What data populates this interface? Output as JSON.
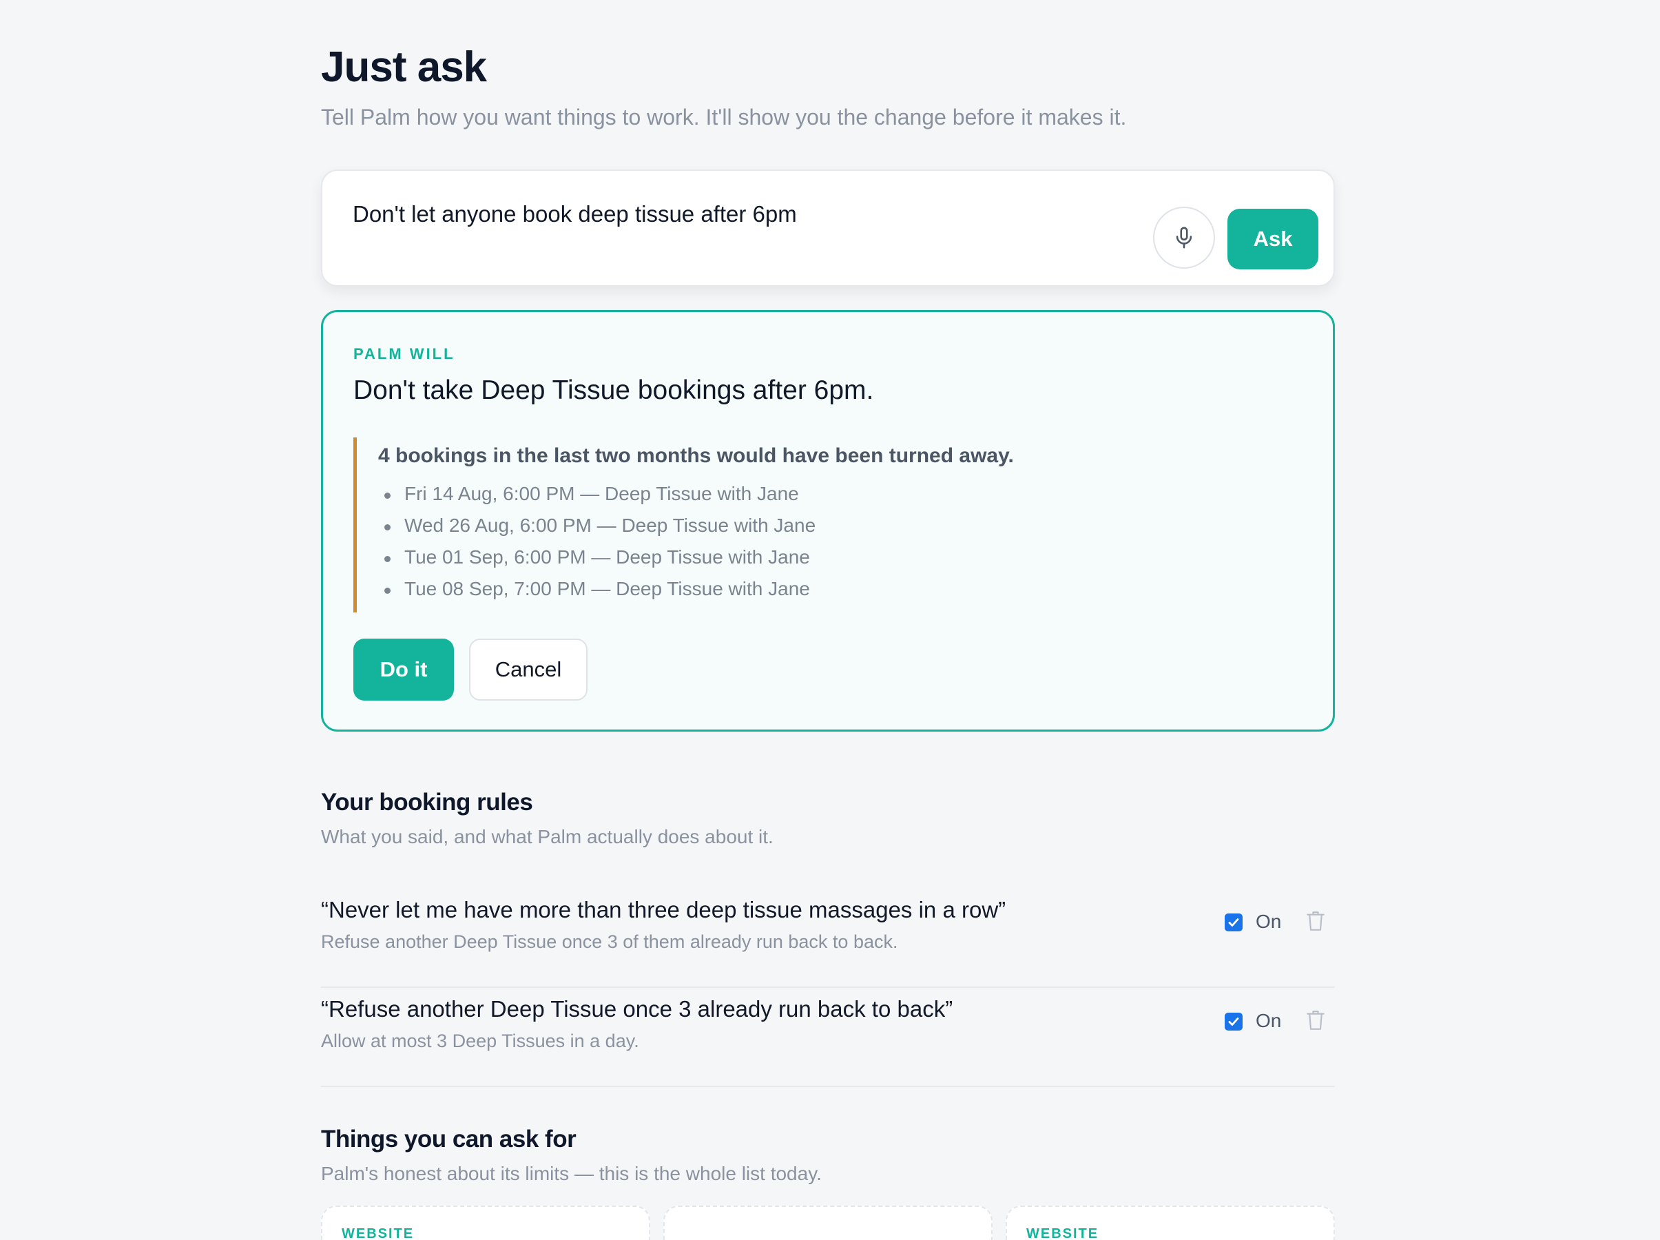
{
  "header": {
    "title": "Just ask",
    "subtitle": "Tell Palm how you want things to work. It'll show you the change before it makes it."
  },
  "ask": {
    "input_value": "Don't let anyone book deep tissue after 6pm",
    "mic_icon": "microphone-icon",
    "ask_label": "Ask"
  },
  "preview": {
    "label": "PALM WILL",
    "summary": "Don't take Deep Tissue bookings after 6pm.",
    "impact_heading": "4 bookings in the last two months would have been turned away.",
    "impact_items": [
      "Fri 14 Aug, 6:00 PM — Deep Tissue with Jane",
      "Wed 26 Aug, 6:00 PM — Deep Tissue with Jane",
      "Tue 01 Sep, 6:00 PM — Deep Tissue with Jane",
      "Tue 08 Sep, 7:00 PM — Deep Tissue with Jane"
    ],
    "confirm_label": "Do it",
    "cancel_label": "Cancel"
  },
  "rules": {
    "title": "Your booking rules",
    "subtitle": "What you said, and what Palm actually does about it.",
    "items": [
      {
        "said": "“Never let me have more than three deep tissue massages in a row”",
        "does": "Refuse another Deep Tissue once 3 of them already run back to back.",
        "enabled": true,
        "toggle_label": "On"
      },
      {
        "said": "“Refuse another Deep Tissue once 3 already run back to back”",
        "does": "Allow at most 3 Deep Tissues in a day.",
        "enabled": true,
        "toggle_label": "On"
      }
    ]
  },
  "capabilities": {
    "title": "Things you can ask for",
    "subtitle": "Palm's honest about its limits — this is the whole list today.",
    "cards": [
      {
        "tag": "WEBSITE"
      },
      {
        "tag": ""
      },
      {
        "tag": "WEBSITE"
      }
    ]
  },
  "colors": {
    "accent": "#14b39b",
    "impact_bar": "#d4892f",
    "checkbox": "#1a73e8",
    "background": "#f5f6f8"
  }
}
